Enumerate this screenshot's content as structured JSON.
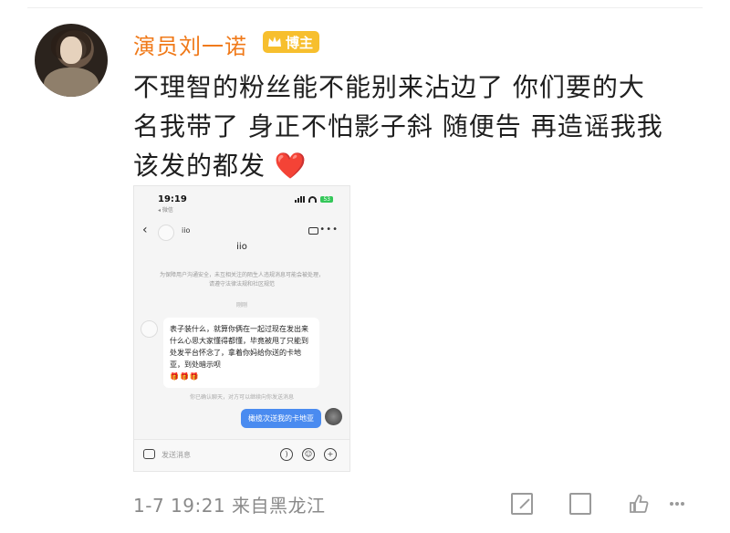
{
  "post": {
    "username": "演员刘一诺",
    "badge_label": "博主",
    "text_lines": [
      "不理智的粉丝能不能别来沾边了 你们要的大",
      "名我带了 身正不怕影子斜 随便告 再造谣我我",
      "该发的都发"
    ],
    "heart_emoji": "❤️",
    "meta": "1-7 19:21 来自黑龙江"
  },
  "screenshot": {
    "status_time": "19:19",
    "status_sub": "◂ 微信",
    "battery": "53",
    "header_name": "iio",
    "chat_title": "iio",
    "notice": "为保障用户沟通安全，未互相关注的陌生人违规消息可能会被处理，请遵守法律法规和社区规范",
    "timestamp": "刚刚",
    "incoming_message": "表子装什么，就算你俩在一起过现在发出来什么心思大家懂得都懂，毕竟被甩了只能到处发平台怀念了，拿着你妈给你送的卡地亚，到处暗示呗",
    "incoming_emojis": "🎁🎁🎁",
    "system_note": "你已确认聊天，对方可以继续向你发送消息",
    "outgoing_message": "橄榄次送我的卡地亚",
    "composer_placeholder": "发送消息"
  },
  "colors": {
    "username": "#f07a1a",
    "badge": "#f7bf2e",
    "outgoing_bubble": "#4a8bf0",
    "heart": "#e5242b"
  },
  "icons": [
    "crown-icon",
    "back-arrow-icon",
    "video-call-icon",
    "more-icon",
    "camera-icon",
    "voice-icon",
    "emoji-icon",
    "plus-icon",
    "share-icon",
    "comment-icon",
    "like-icon"
  ]
}
